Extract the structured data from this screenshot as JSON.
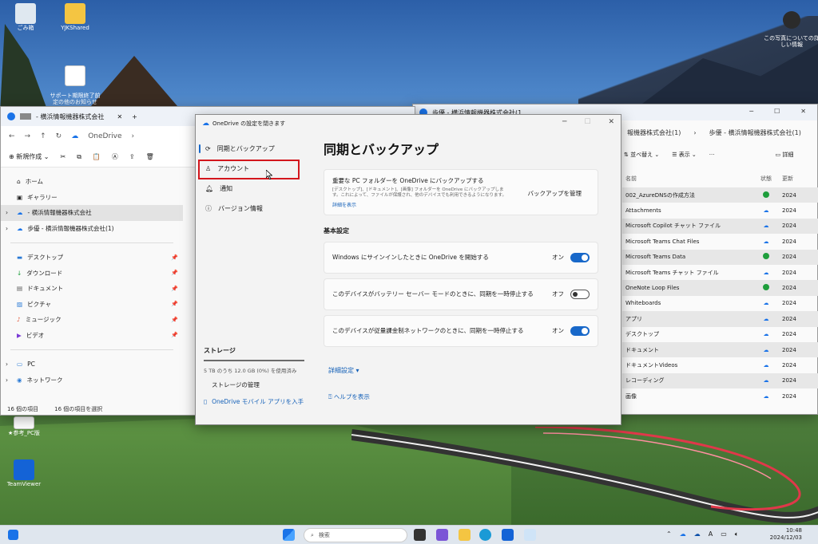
{
  "desktop": {
    "icons": [
      {
        "label": "ごみ箱"
      },
      {
        "label": "YJKShared"
      },
      {
        "label": "サポート期限終了前\n定の他のお知らせ"
      },
      {
        "label": "★参考_PC版"
      },
      {
        "label": "TeamViewer"
      }
    ],
    "photo_info": "この写真についての詳\nしい情報"
  },
  "explorer_left": {
    "title": "- 横浜情報機器株式会社",
    "breadcrumb": "OneDrive",
    "new_button": "新規作成",
    "nav": {
      "home": "ホーム",
      "gallery": "ギャラリー",
      "onedrive_company": "- 横浜情報機器株式会社",
      "onedrive_shared": "歩優 - 横浜情報機器株式会社(1)",
      "desktop": "デスクトップ",
      "downloads": "ダウンロード",
      "documents": "ドキュメント",
      "pictures": "ピクチャ",
      "music": "ミュージック",
      "videos": "ビデオ",
      "pc": "PC",
      "network": "ネットワーク"
    },
    "status_count": "16 個の項目",
    "status_selected": "16 個の項目を選択"
  },
  "explorer_right": {
    "title": "歩優 - 横浜情報機器株式会社(1",
    "breadcrumb_1": "報機器株式会社(1)",
    "breadcrumb_2": "歩優 - 横浜情報機器株式会社(1)",
    "sort_button": "並べ替え",
    "view_button": "表示",
    "details_button": "詳細",
    "col_name": "名前",
    "col_status": "状態",
    "col_date": "更新",
    "rows": [
      {
        "name": "002_AzureDNSの作成方法",
        "status": "ok",
        "date": "2024"
      },
      {
        "name": "Attachments",
        "status": "cloud",
        "date": "2024"
      },
      {
        "name": "Microsoft Copilot チャット ファイル",
        "status": "cloud",
        "date": "2024"
      },
      {
        "name": "Microsoft Teams Chat Files",
        "status": "cloud",
        "date": "2024"
      },
      {
        "name": "Microsoft Teams Data",
        "status": "ok",
        "date": "2024"
      },
      {
        "name": "Microsoft Teams チャット ファイル",
        "status": "cloud",
        "date": "2024"
      },
      {
        "name": "OneNote Loop Files",
        "status": "ok",
        "date": "2024"
      },
      {
        "name": "Whiteboards",
        "status": "cloud",
        "date": "2024"
      },
      {
        "name": "アプリ",
        "status": "cloud",
        "date": "2024"
      },
      {
        "name": "デスクトップ",
        "status": "cloud",
        "date": "2024"
      },
      {
        "name": "ドキュメント",
        "status": "cloud",
        "date": "2024"
      },
      {
        "name": "ドキュメントVideos",
        "status": "cloud",
        "date": "2024"
      },
      {
        "name": "レコーディング",
        "status": "cloud",
        "date": "2024"
      },
      {
        "name": "画像",
        "status": "cloud",
        "date": "2024"
      }
    ]
  },
  "settings": {
    "title": "OneDrive の設定を閉きます",
    "menu": {
      "sync": "同期とバックアップ",
      "account": "アカウント",
      "notify": "通知",
      "version": "バージョン情報"
    },
    "storage": {
      "heading": "ストレージ",
      "usage": "5 TB のうち 12.0 GB (0%) を使用済み",
      "manage": "ストレージの管理",
      "mobile": "OneDrive モバイル アプリを入手"
    },
    "page_title": "同期とバックアップ",
    "backup_card": {
      "title": "重要な PC フォルダーを OneDrive にバックアップする",
      "desc": "[デスクトップ]、[ドキュメント]、[画像] フォルダーを OneDrive にバックアップします。これによって、ファイルが保護され、他のデバイスでも利用できるようになります。",
      "link": "詳細を表示",
      "action": "バックアップを管理"
    },
    "basic_heading": "基本設定",
    "toggles": [
      {
        "label": "Windows にサインインしたときに OneDrive を開始する",
        "state": "オン",
        "on": true
      },
      {
        "label": "このデバイスがバッテリー セーバー モードのときに、同期を一時停止する",
        "state": "オフ",
        "on": false
      },
      {
        "label": "このデバイスが従量課金制ネットワークのときに、同期を一時停止する",
        "state": "オン",
        "on": true
      }
    ],
    "advanced": "詳細設定",
    "help": "ヘルプを表示"
  },
  "taskbar": {
    "search_placeholder": "検索",
    "time": "10:48",
    "date": "2024/12/03"
  },
  "colors": {
    "accent": "#1868c9",
    "highlight_box": "#d3161d",
    "sync_ok": "#1e9e3c"
  }
}
